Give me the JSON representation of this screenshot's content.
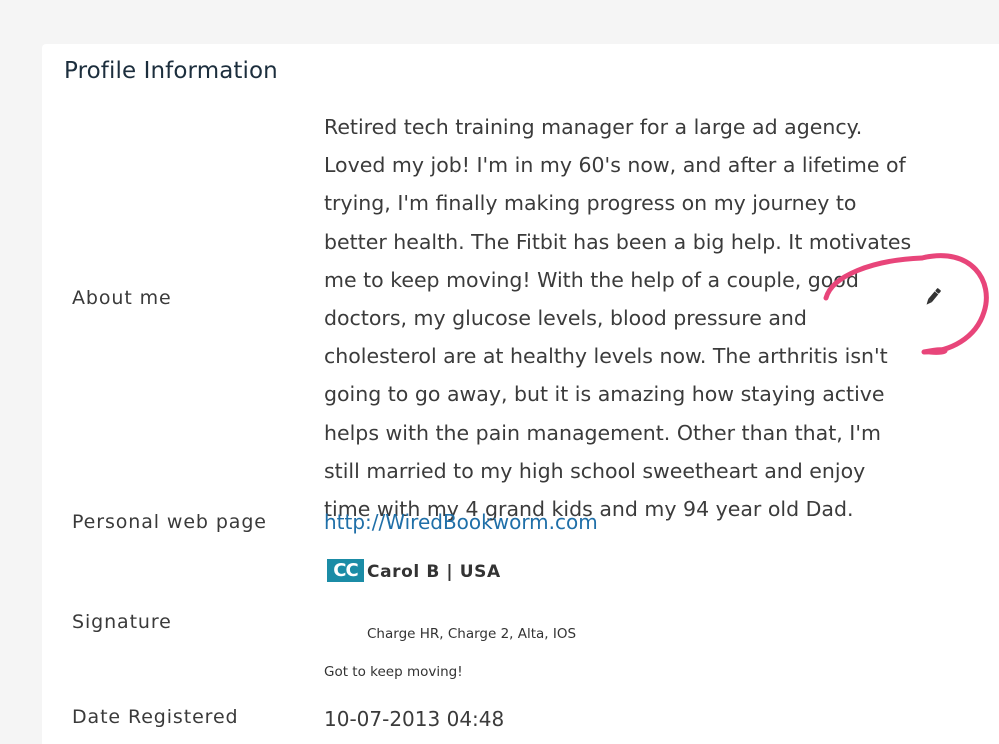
{
  "profile": {
    "title": "Profile Information",
    "about": {
      "label": "About me",
      "text": "Retired tech training manager for a large ad agency. Loved my job! I'm in my 60's now, and after a lifetime of trying, I'm finally making progress on my journey to better health. The Fitbit has been a big help. It motivates me to keep moving! With the help of a couple, good doctors, my glucose levels, blood pressure and cholesterol are at healthy levels now. The arthritis isn't going to go away, but it is amazing how staying active helps with the pain management. Other than that, I'm still married to my high school sweetheart and enjoy time with my 4 grand kids and my 94 year old Dad."
    },
    "web_page": {
      "label": "Personal web page",
      "url": "http://WiredBookworm.com"
    },
    "signature": {
      "label": "Signature",
      "avatar_initials": "CC",
      "name": "Carol B | USA",
      "devices": "Charge HR, Charge 2, Alta, IOS",
      "motto": "Got to keep moving!"
    },
    "registered": {
      "label": "Date Registered",
      "value": "10-07-2013 04:48"
    }
  },
  "colors": {
    "annotation": "#e8457a",
    "link": "#1f6fa8",
    "avatar_bg": "#1b8ca6"
  },
  "icons": {
    "edit": "pencil-icon"
  }
}
